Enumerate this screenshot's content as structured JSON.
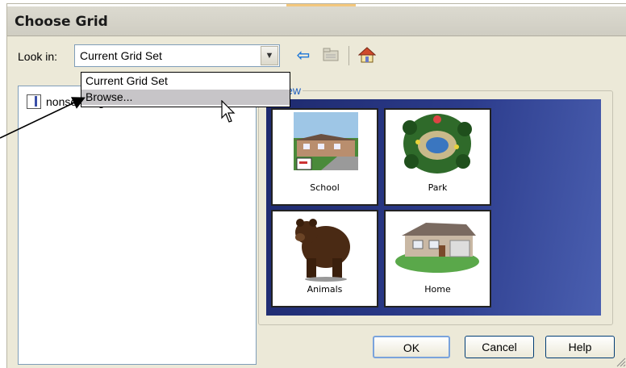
{
  "dialog": {
    "title": "Choose Grid",
    "look_in_label": "Look in:",
    "look_in_value": "Current Grid Set",
    "dropdown_options": [
      "Current Grid Set",
      "Browse..."
    ],
    "highlighted_option": "Browse...",
    "list_item": "nonsending1",
    "preview_legend": "view",
    "preview_cards": [
      {
        "label": "School"
      },
      {
        "label": "Park"
      },
      {
        "label": "Animals"
      },
      {
        "label": "Home"
      }
    ],
    "buttons": {
      "ok": "OK",
      "cancel": "Cancel",
      "help": "Help"
    }
  },
  "icons": [
    "chevron-down-icon",
    "back-arrow-icon",
    "folder-icon",
    "home-icon",
    "mouse-cursor-icon"
  ],
  "colors": {
    "preview_bg": "#2c3c8c",
    "dialog_bg": "#ece9d8",
    "highlight": "#c7c5c8"
  }
}
